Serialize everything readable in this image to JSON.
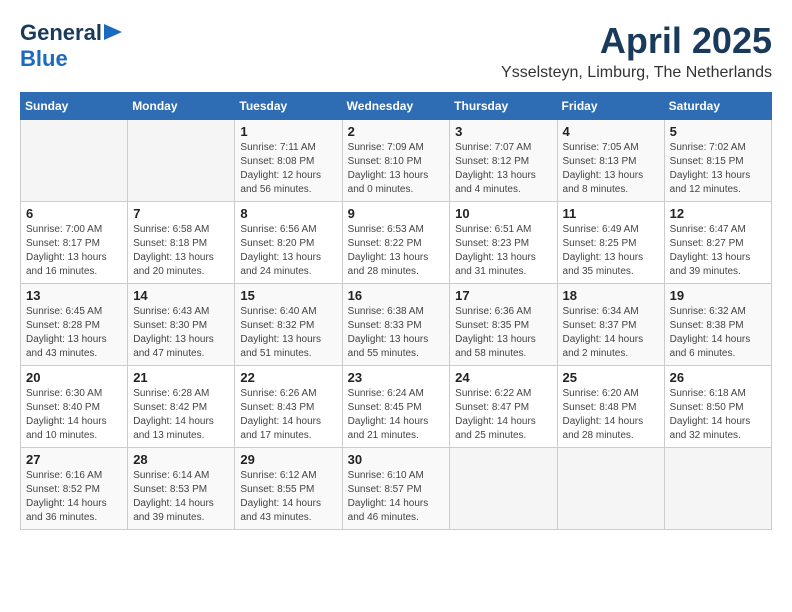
{
  "header": {
    "logo": {
      "general": "General",
      "blue": "Blue"
    },
    "title": "April 2025",
    "location": "Ysselsteyn, Limburg, The Netherlands"
  },
  "calendar": {
    "days_of_week": [
      "Sunday",
      "Monday",
      "Tuesday",
      "Wednesday",
      "Thursday",
      "Friday",
      "Saturday"
    ],
    "weeks": [
      [
        {
          "day": "",
          "detail": ""
        },
        {
          "day": "",
          "detail": ""
        },
        {
          "day": "1",
          "detail": "Sunrise: 7:11 AM\nSunset: 8:08 PM\nDaylight: 12 hours\nand 56 minutes."
        },
        {
          "day": "2",
          "detail": "Sunrise: 7:09 AM\nSunset: 8:10 PM\nDaylight: 13 hours\nand 0 minutes."
        },
        {
          "day": "3",
          "detail": "Sunrise: 7:07 AM\nSunset: 8:12 PM\nDaylight: 13 hours\nand 4 minutes."
        },
        {
          "day": "4",
          "detail": "Sunrise: 7:05 AM\nSunset: 8:13 PM\nDaylight: 13 hours\nand 8 minutes."
        },
        {
          "day": "5",
          "detail": "Sunrise: 7:02 AM\nSunset: 8:15 PM\nDaylight: 13 hours\nand 12 minutes."
        }
      ],
      [
        {
          "day": "6",
          "detail": "Sunrise: 7:00 AM\nSunset: 8:17 PM\nDaylight: 13 hours\nand 16 minutes."
        },
        {
          "day": "7",
          "detail": "Sunrise: 6:58 AM\nSunset: 8:18 PM\nDaylight: 13 hours\nand 20 minutes."
        },
        {
          "day": "8",
          "detail": "Sunrise: 6:56 AM\nSunset: 8:20 PM\nDaylight: 13 hours\nand 24 minutes."
        },
        {
          "day": "9",
          "detail": "Sunrise: 6:53 AM\nSunset: 8:22 PM\nDaylight: 13 hours\nand 28 minutes."
        },
        {
          "day": "10",
          "detail": "Sunrise: 6:51 AM\nSunset: 8:23 PM\nDaylight: 13 hours\nand 31 minutes."
        },
        {
          "day": "11",
          "detail": "Sunrise: 6:49 AM\nSunset: 8:25 PM\nDaylight: 13 hours\nand 35 minutes."
        },
        {
          "day": "12",
          "detail": "Sunrise: 6:47 AM\nSunset: 8:27 PM\nDaylight: 13 hours\nand 39 minutes."
        }
      ],
      [
        {
          "day": "13",
          "detail": "Sunrise: 6:45 AM\nSunset: 8:28 PM\nDaylight: 13 hours\nand 43 minutes."
        },
        {
          "day": "14",
          "detail": "Sunrise: 6:43 AM\nSunset: 8:30 PM\nDaylight: 13 hours\nand 47 minutes."
        },
        {
          "day": "15",
          "detail": "Sunrise: 6:40 AM\nSunset: 8:32 PM\nDaylight: 13 hours\nand 51 minutes."
        },
        {
          "day": "16",
          "detail": "Sunrise: 6:38 AM\nSunset: 8:33 PM\nDaylight: 13 hours\nand 55 minutes."
        },
        {
          "day": "17",
          "detail": "Sunrise: 6:36 AM\nSunset: 8:35 PM\nDaylight: 13 hours\nand 58 minutes."
        },
        {
          "day": "18",
          "detail": "Sunrise: 6:34 AM\nSunset: 8:37 PM\nDaylight: 14 hours\nand 2 minutes."
        },
        {
          "day": "19",
          "detail": "Sunrise: 6:32 AM\nSunset: 8:38 PM\nDaylight: 14 hours\nand 6 minutes."
        }
      ],
      [
        {
          "day": "20",
          "detail": "Sunrise: 6:30 AM\nSunset: 8:40 PM\nDaylight: 14 hours\nand 10 minutes."
        },
        {
          "day": "21",
          "detail": "Sunrise: 6:28 AM\nSunset: 8:42 PM\nDaylight: 14 hours\nand 13 minutes."
        },
        {
          "day": "22",
          "detail": "Sunrise: 6:26 AM\nSunset: 8:43 PM\nDaylight: 14 hours\nand 17 minutes."
        },
        {
          "day": "23",
          "detail": "Sunrise: 6:24 AM\nSunset: 8:45 PM\nDaylight: 14 hours\nand 21 minutes."
        },
        {
          "day": "24",
          "detail": "Sunrise: 6:22 AM\nSunset: 8:47 PM\nDaylight: 14 hours\nand 25 minutes."
        },
        {
          "day": "25",
          "detail": "Sunrise: 6:20 AM\nSunset: 8:48 PM\nDaylight: 14 hours\nand 28 minutes."
        },
        {
          "day": "26",
          "detail": "Sunrise: 6:18 AM\nSunset: 8:50 PM\nDaylight: 14 hours\nand 32 minutes."
        }
      ],
      [
        {
          "day": "27",
          "detail": "Sunrise: 6:16 AM\nSunset: 8:52 PM\nDaylight: 14 hours\nand 36 minutes."
        },
        {
          "day": "28",
          "detail": "Sunrise: 6:14 AM\nSunset: 8:53 PM\nDaylight: 14 hours\nand 39 minutes."
        },
        {
          "day": "29",
          "detail": "Sunrise: 6:12 AM\nSunset: 8:55 PM\nDaylight: 14 hours\nand 43 minutes."
        },
        {
          "day": "30",
          "detail": "Sunrise: 6:10 AM\nSunset: 8:57 PM\nDaylight: 14 hours\nand 46 minutes."
        },
        {
          "day": "",
          "detail": ""
        },
        {
          "day": "",
          "detail": ""
        },
        {
          "day": "",
          "detail": ""
        }
      ]
    ]
  }
}
